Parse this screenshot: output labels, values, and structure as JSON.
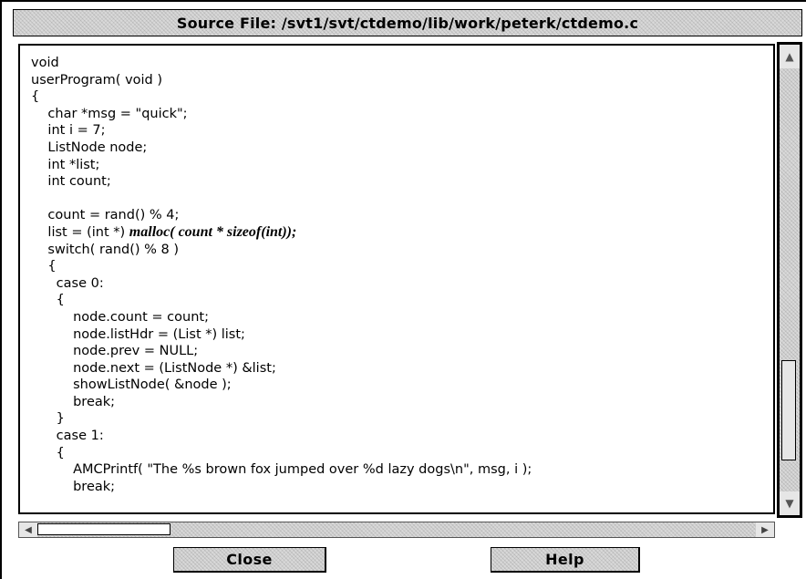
{
  "window": {
    "title": "Source File: /svt1/svt/ctdemo/lib/work/peterk/ctdemo.c"
  },
  "source": {
    "lines": [
      {
        "text": "void"
      },
      {
        "text": "userProgram( void )"
      },
      {
        "text": "{"
      },
      {
        "text": "    char *msg = \"quick\";"
      },
      {
        "text": "    int i = 7;"
      },
      {
        "text": "    ListNode node;"
      },
      {
        "text": "    int *list;"
      },
      {
        "text": "    int count;"
      },
      {
        "text": ""
      },
      {
        "text": "    count = rand() % 4;"
      },
      {
        "text": "    list = (int *) ",
        "highlight": "malloc( count * sizeof(int));"
      },
      {
        "text": "    switch( rand() % 8 )"
      },
      {
        "text": "    {"
      },
      {
        "text": "      case 0:"
      },
      {
        "text": "      {"
      },
      {
        "text": "          node.count = count;"
      },
      {
        "text": "          node.listHdr = (List *) list;"
      },
      {
        "text": "          node.prev = NULL;"
      },
      {
        "text": "          node.next = (ListNode *) &list;"
      },
      {
        "text": "          showListNode( &node );"
      },
      {
        "text": "          break;"
      },
      {
        "text": "      }"
      },
      {
        "text": "      case 1:"
      },
      {
        "text": "      {"
      },
      {
        "text": "          AMCPrintf( \"The %s brown fox jumped over %d lazy dogs\\n\", msg, i );"
      },
      {
        "text": "          break;"
      }
    ]
  },
  "vertical_scrollbar": {
    "up_icon": "arrow-up-icon",
    "down_icon": "arrow-down-icon"
  },
  "horizontal_scrollbar": {
    "left_icon": "arrow-left-icon",
    "right_icon": "arrow-right-icon"
  },
  "buttons": {
    "close_label": "Close",
    "help_label": "Help"
  }
}
